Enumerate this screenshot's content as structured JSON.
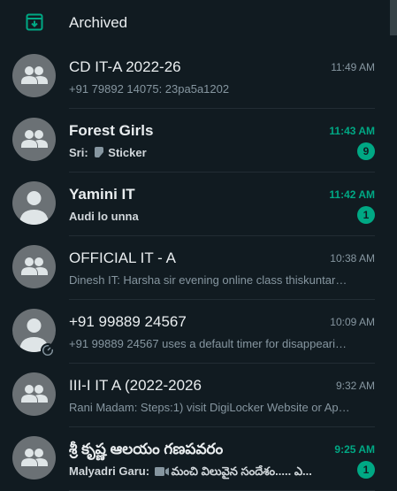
{
  "archived": {
    "label": "Archived",
    "icon": "archive-icon"
  },
  "colors": {
    "accent": "#00a884",
    "background": "#111b21",
    "muted": "#8696a0",
    "text": "#e9edef"
  },
  "chats": [
    {
      "name": "CD IT-A 2022-26",
      "time": "11:49 AM",
      "preview": "+91 79892 14075: 23pa5a1202",
      "unread": null,
      "avatar": "group-avatar-icon"
    },
    {
      "name": "Forest Girls",
      "time": "11:43 AM",
      "sender": "Sri:",
      "media": "sticker-icon",
      "preview": "Sticker",
      "unread": "9",
      "avatar": "group-avatar-icon"
    },
    {
      "name": "Yamini IT",
      "time": "11:42 AM",
      "preview": "Audi lo unna",
      "unread": "1",
      "avatar": "person-avatar-icon"
    },
    {
      "name": "OFFICIAL IT - A",
      "time": "10:38 AM",
      "preview": "Dinesh IT: Harsha sir evening online class thiskuntaru a...",
      "unread": null,
      "avatar": "group-avatar-icon"
    },
    {
      "name": "+91 99889 24567",
      "time": "10:09 AM",
      "preview": "+91 99889 24567 uses a default timer for disappearing...",
      "unread": null,
      "avatar": "person-avatar-icon",
      "timer": true
    },
    {
      "name": "III-I IT A (2022-2026",
      "time": "9:32 AM",
      "preview": "Rani Madam: Steps:1) visit DigiLocker Website or App...",
      "unread": null,
      "avatar": "group-avatar-icon"
    },
    {
      "name": "శ్రీ కృష్ణ ఆలయం గణపవరం",
      "time": "9:25 AM",
      "sender": "Malyadri Garu:",
      "media": "video-icon",
      "preview": "మంచి విలువైన సందేశం..... ఎ...",
      "unread": "1",
      "avatar": "group-avatar-icon"
    }
  ]
}
